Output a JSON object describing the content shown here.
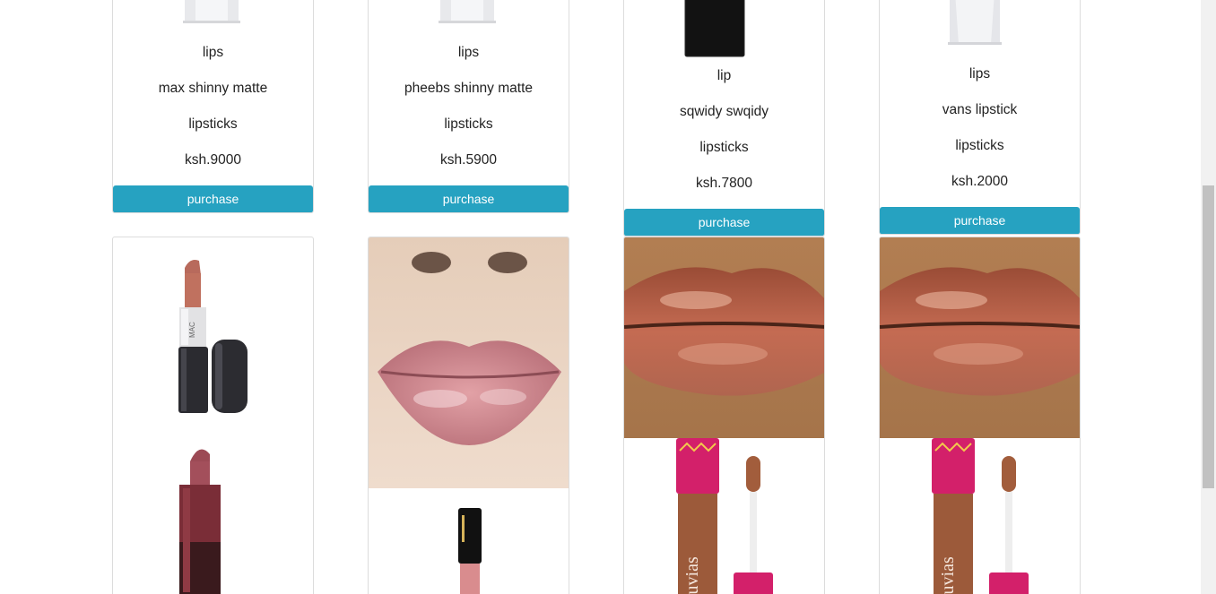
{
  "products_top": [
    {
      "category": "lips",
      "name": "max shinny matte",
      "type": "lipsticks",
      "price": "ksh.9000",
      "button": "purchase"
    },
    {
      "category": "lips",
      "name": "pheebs shinny matte",
      "type": "lipsticks",
      "price": "ksh.5900",
      "button": "purchase"
    },
    {
      "category": "lip",
      "name": "sqwidy swqidy",
      "type": "lipsticks",
      "price": "ksh.7800",
      "button": "purchase"
    },
    {
      "category": "lips",
      "name": "vans lipstick",
      "type": "lipsticks",
      "price": "ksh.2000",
      "button": "purchase"
    }
  ],
  "brand_logo_text": "MAC",
  "brand_logo_text_2": "juvias",
  "colors": {
    "button": "#26a2c1",
    "card_border": "#dcdcdc",
    "lip_gloss_pink": "#c9818a",
    "lip_nude": "#b0654f"
  }
}
